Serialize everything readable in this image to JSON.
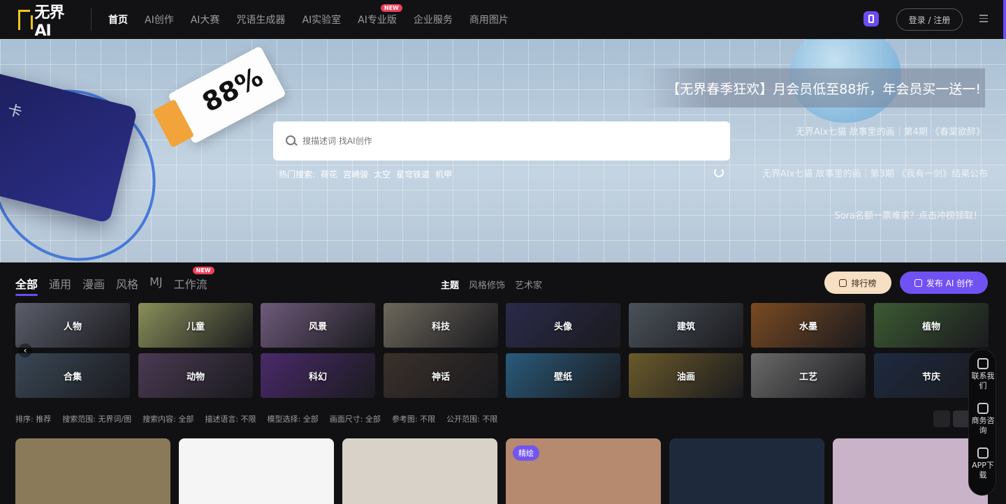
{
  "header": {
    "logo": "无界AI",
    "nav": [
      {
        "label": "首页",
        "active": true
      },
      {
        "label": "AI创作"
      },
      {
        "label": "AI大赛"
      },
      {
        "label": "咒语生成器"
      },
      {
        "label": "AI实验室"
      },
      {
        "label": "AI专业版",
        "badge": "NEW"
      },
      {
        "label": "企业服务"
      },
      {
        "label": "商用图片"
      }
    ],
    "login_label": "登录 / 注册"
  },
  "hero": {
    "ticket_text": "88%",
    "card_text": "卡",
    "promo": "【无界春季狂欢】月会员低至88折，年会员买一送一!",
    "news": [
      "无界AIx七猫 故事里的画｜第4期 《春棠欲醉》",
      "无界AIx七猫 故事里的画｜第3期 《我有一剑》结果公布",
      "Sora名额一票难求？点击冲榜领取！"
    ],
    "search_placeholder": "搜描述词 找AI创作",
    "hot_label": "热门搜索:",
    "hot_terms": [
      "荷花",
      "宫崎骏",
      "太空",
      "星穹铁道",
      "机甲"
    ]
  },
  "category_bar": {
    "tabs": [
      "全部",
      "通用",
      "漫画",
      "风格",
      "MJ",
      "工作流"
    ],
    "tab_badge": "NEW",
    "subtabs": [
      "主题",
      "风格修饰",
      "艺术家"
    ],
    "rank_label": "排行榜",
    "publish_label": "发布 AI 创作"
  },
  "tiles": [
    {
      "label": "人物",
      "color": "#5b5e6a"
    },
    {
      "label": "儿童",
      "color": "#8a8f5a"
    },
    {
      "label": "风景",
      "color": "#6e5a7a"
    },
    {
      "label": "科技",
      "color": "#6d675c"
    },
    {
      "label": "头像",
      "color": "#2a2a4a"
    },
    {
      "label": "建筑",
      "color": "#4a5259"
    },
    {
      "label": "水墨",
      "color": "#7a4a22"
    },
    {
      "label": "植物",
      "color": "#3c5a32"
    },
    {
      "label": "合集",
      "color": "#3a4856"
    },
    {
      "label": "动物",
      "color": "#4a3a52"
    },
    {
      "label": "科幻",
      "color": "#4a2a6a"
    },
    {
      "label": "神话",
      "color": "#3a302a"
    },
    {
      "label": "壁纸",
      "color": "#2a5a7a"
    },
    {
      "label": "油画",
      "color": "#6a5a2a"
    },
    {
      "label": "工艺",
      "color": "#6a6a6a"
    },
    {
      "label": "节庆",
      "color": "#1e2a40"
    }
  ],
  "filters": [
    "排序: 推荐",
    "搜索范围: 无界词/图",
    "搜索内容: 全部",
    "描述语言: 不限",
    "模型选择: 全部",
    "画面尺寸: 全部",
    "参考图: 不限",
    "公开范围: 不限"
  ],
  "gallery": [
    {
      "tag": "",
      "color": "#8a7a5a"
    },
    {
      "tag": "",
      "color": "#f5f5f5"
    },
    {
      "tag": "",
      "color": "#d9d2c8"
    },
    {
      "tag": "精绘",
      "color": "#b58a6e"
    },
    {
      "tag": "",
      "color": "#1e2a3c"
    },
    {
      "tag": "",
      "color": "#c9b3c8"
    }
  ],
  "float_panel": [
    "联系我们",
    "商务咨询",
    "APP下载"
  ]
}
